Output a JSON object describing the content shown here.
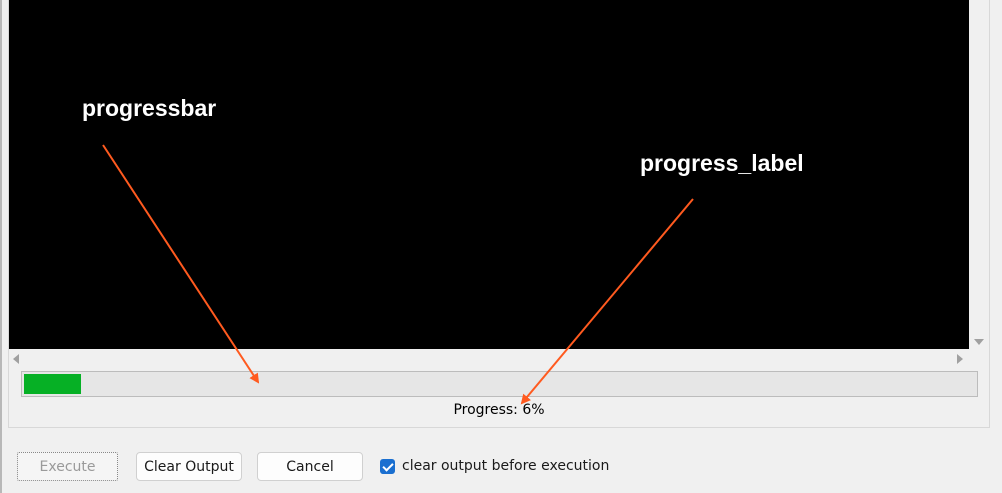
{
  "annotations": {
    "progressbar_label": "progressbar",
    "progress_label_label": "progress_label",
    "arrow_color": "#ff5a1f"
  },
  "progress": {
    "percent": 6,
    "label": "Progress: 6%",
    "fill_color": "#06b025"
  },
  "buttons": {
    "execute": "Execute",
    "clear_output": "Clear Output",
    "cancel": "Cancel"
  },
  "options": {
    "clear_before_execution_label": "clear output before execution",
    "clear_before_execution_checked": true
  },
  "icons": {
    "scroll_down": "triangle-down-icon",
    "scroll_left": "triangle-left-icon",
    "scroll_right": "triangle-right-icon",
    "checkbox": "checkmark-icon"
  }
}
